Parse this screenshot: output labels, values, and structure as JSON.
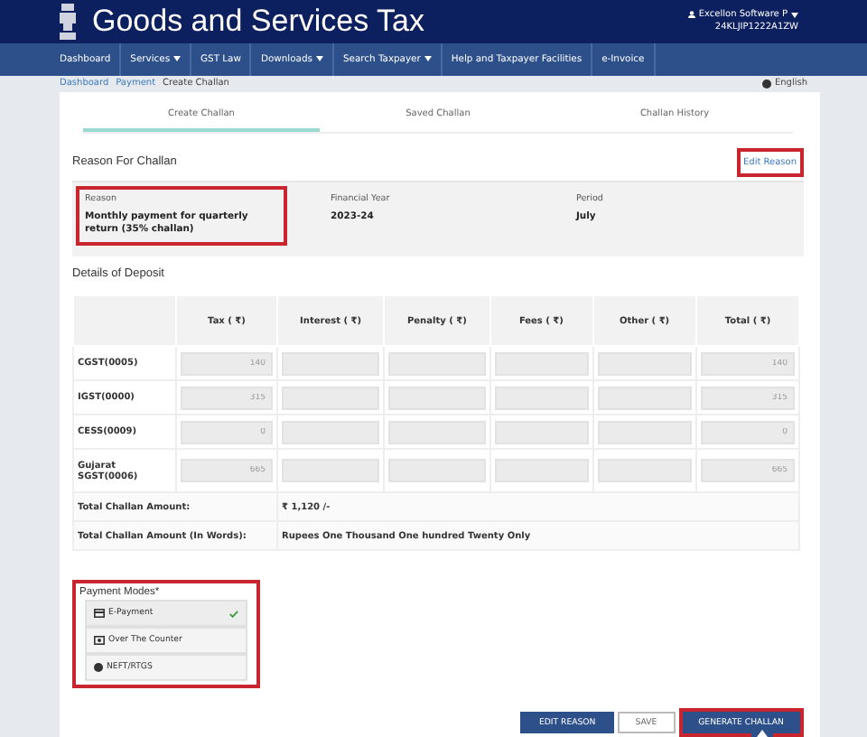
{
  "header": {
    "title": "Goods and Services Tax",
    "user": "Excellon Software P",
    "gstin": "24KLJIP1222A1ZW"
  },
  "nav": [
    {
      "label": "Dashboard",
      "dropdown": false
    },
    {
      "label": "Services",
      "dropdown": true
    },
    {
      "label": "GST Law",
      "dropdown": false
    },
    {
      "label": "Downloads",
      "dropdown": true
    },
    {
      "label": "Search Taxpayer",
      "dropdown": true
    },
    {
      "label": "Help and Taxpayer Facilities",
      "dropdown": false
    },
    {
      "label": "e-Invoice",
      "dropdown": false
    }
  ],
  "breadcrumb": [
    "Dashboard",
    "Payment",
    "Create Challan"
  ],
  "language": "English",
  "tabs": [
    {
      "label": "Create Challan",
      "selected": true
    },
    {
      "label": "Saved Challan",
      "selected": false
    },
    {
      "label": "Challan History",
      "selected": false
    }
  ],
  "reason_section": {
    "title": "Reason For Challan",
    "edit_link": {
      "label": "Edit Reason",
      "highlighted": true
    },
    "fields": [
      {
        "label": "Reason",
        "value": "Monthly payment for quarterly return (35% challan)",
        "highlighted": true
      },
      {
        "label": "Financial Year",
        "value": "2023-24",
        "highlighted": false
      },
      {
        "label": "Period",
        "value": "July",
        "highlighted": false
      }
    ]
  },
  "deposit": {
    "title": "Details of Deposit",
    "columns": [
      "Tax ( ₹)",
      "Interest ( ₹)",
      "Penalty ( ₹)",
      "Fees ( ₹)",
      "Other ( ₹)",
      "Total ( ₹)"
    ],
    "rows": [
      {
        "label": "CGST(0005)",
        "tax": "140",
        "total": "140"
      },
      {
        "label": "IGST(0000)",
        "tax": "315",
        "total": "315"
      },
      {
        "label": "CESS(0009)",
        "tax": "0",
        "total": "0"
      },
      {
        "label": "Gujarat SGST(0006)",
        "tax": "665",
        "total": "665"
      }
    ],
    "totals": [
      {
        "label": "Total Challan Amount:",
        "value": "₹ 1,120 /-"
      },
      {
        "label": "Total Challan Amount (In Words):",
        "value": "Rupees One Thousand One hundred Twenty Only"
      }
    ]
  },
  "payment_modes": {
    "title": "Payment Modes*",
    "highlighted": true,
    "options": [
      {
        "label": "E-Payment",
        "kind": "card",
        "selected": true
      },
      {
        "label": "Over The Counter",
        "kind": "cash",
        "selected": false
      },
      {
        "label": "NEFT/RTGS",
        "kind": "globe",
        "selected": false
      }
    ]
  },
  "buttons": [
    {
      "label": "EDIT REASON",
      "kind": "primary",
      "highlighted": false
    },
    {
      "label": "SAVE",
      "kind": "outline",
      "highlighted": false
    },
    {
      "label": "GENERATE CHALLAN",
      "kind": "primary",
      "highlighted": true
    }
  ]
}
